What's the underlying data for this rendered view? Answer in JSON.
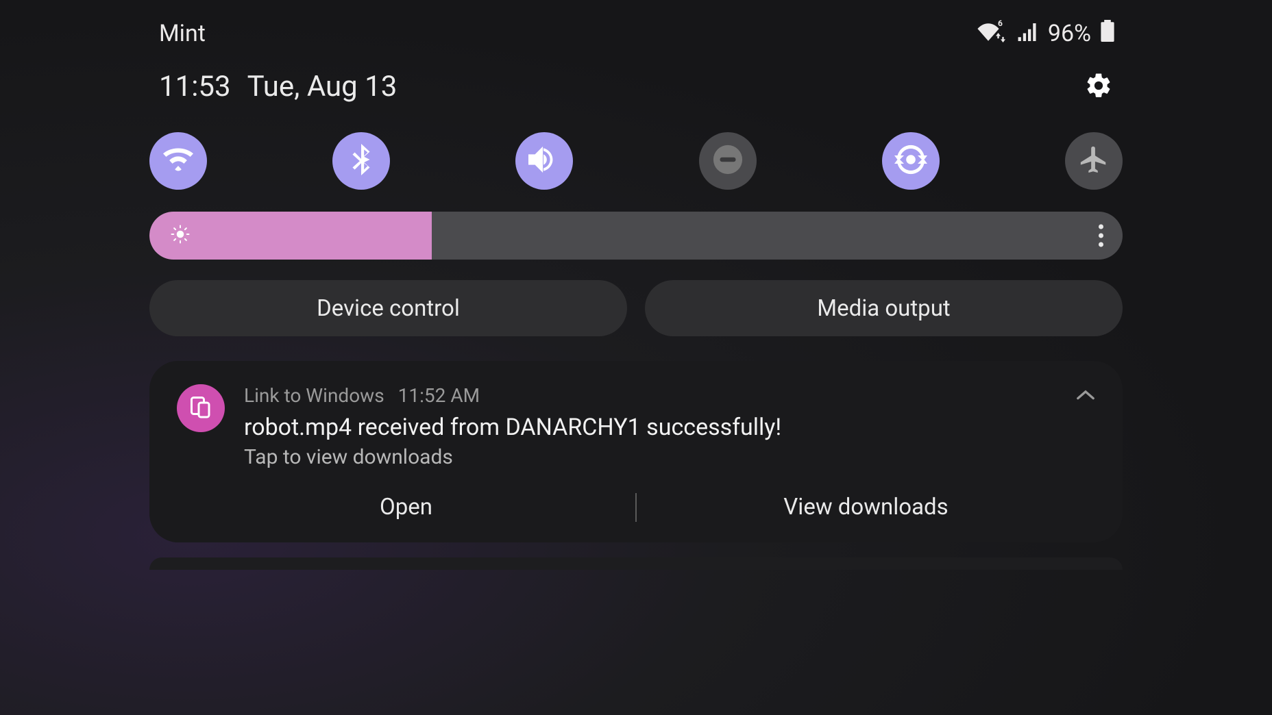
{
  "status_bar": {
    "carrier": "Mint",
    "battery_pct": "96%"
  },
  "time_row": {
    "time": "11:53",
    "date": "Tue, Aug 13"
  },
  "brightness": {
    "fill_pct": 29
  },
  "controls": {
    "device_control": "Device control",
    "media_output": "Media output"
  },
  "notification": {
    "app": "Link to Windows",
    "timestamp": "11:52 AM",
    "title": "robot.mp4 received from DANARCHY1 successfully!",
    "subtitle": "Tap to view downloads",
    "action_open": "Open",
    "action_view": "View downloads"
  }
}
